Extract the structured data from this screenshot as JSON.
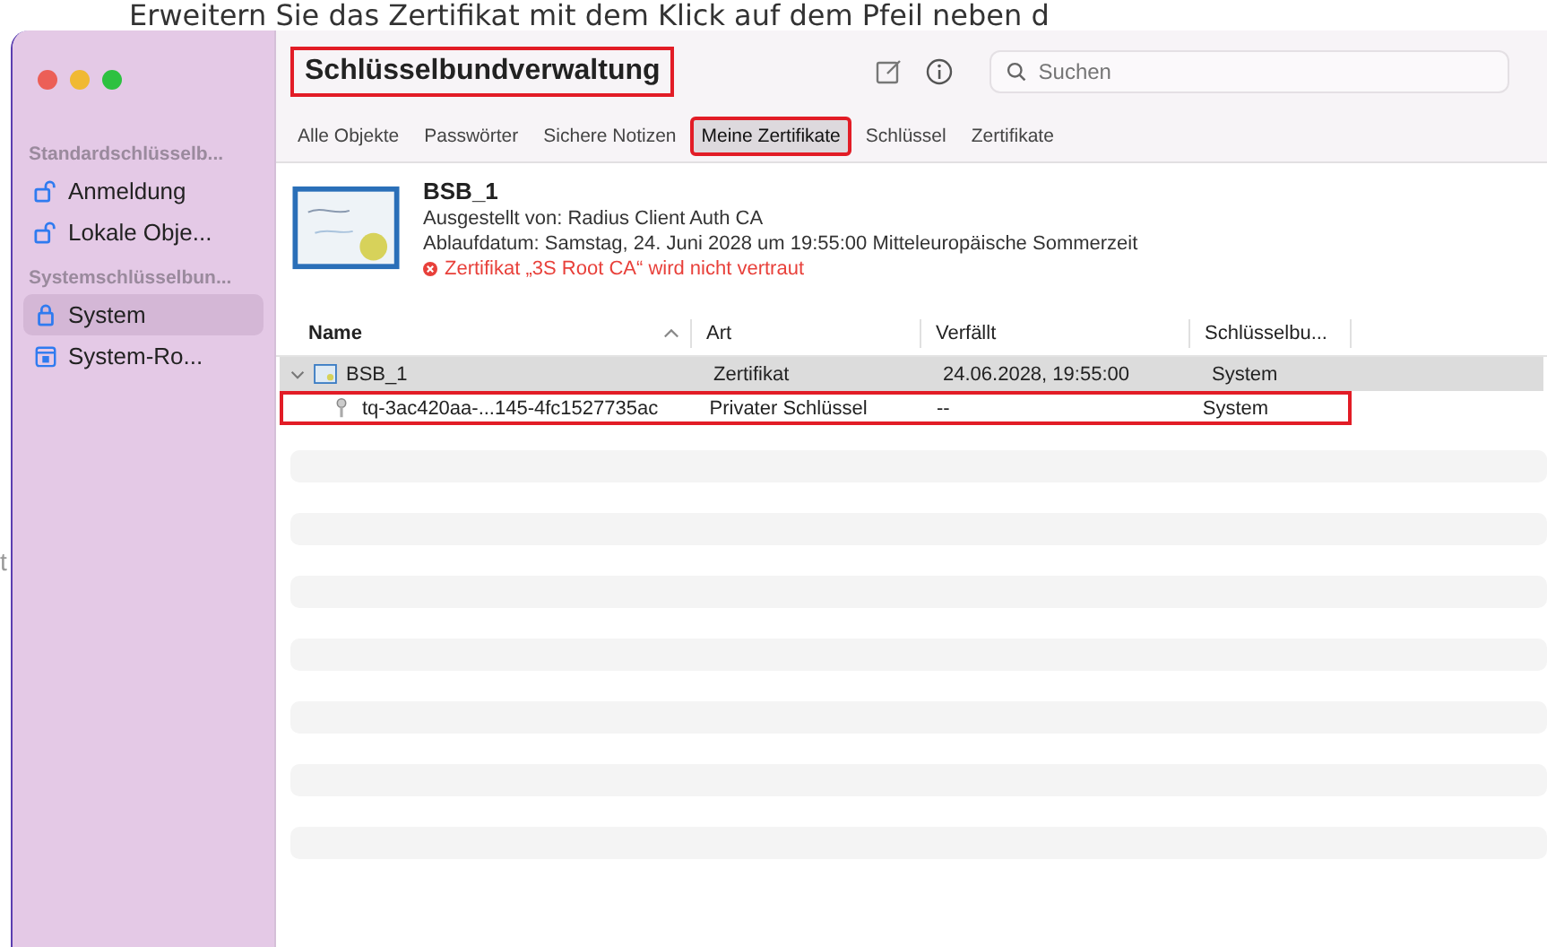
{
  "caption": "Erweitern Sie das Zertifikat mit dem Klick auf dem Pfeil neben d",
  "side_fragment": "t",
  "window": {
    "title": "Schlüsselbundverwaltung",
    "title_annotated": true
  },
  "toolbar": {
    "search": {
      "placeholder": "Suchen"
    }
  },
  "sidebar": {
    "sections": [
      {
        "heading": "Standardschlüsselb...",
        "items": [
          {
            "label": "Anmeldung",
            "kind": "unlocked",
            "selected": false
          },
          {
            "label": "Lokale Obje...",
            "kind": "unlocked",
            "selected": false
          }
        ]
      },
      {
        "heading": "Systemschlüsselbun...",
        "items": [
          {
            "label": "System",
            "kind": "locked",
            "selected": true
          },
          {
            "label": "System-Ro...",
            "kind": "cabinet",
            "selected": false
          }
        ]
      }
    ]
  },
  "tabs": [
    {
      "label": "Alle Objekte",
      "selected": false,
      "annotated": false
    },
    {
      "label": "Passwörter",
      "selected": false,
      "annotated": false
    },
    {
      "label": "Sichere Notizen",
      "selected": false,
      "annotated": false
    },
    {
      "label": "Meine Zertifikate",
      "selected": true,
      "annotated": true
    },
    {
      "label": "Schlüssel",
      "selected": false,
      "annotated": false
    },
    {
      "label": "Zertifikate",
      "selected": false,
      "annotated": false
    }
  ],
  "details": {
    "name": "BSB_1",
    "issuer": "Ausgestellt von: Radius Client Auth CA",
    "expiry": "Ablaufdatum: Samstag, 24. Juni 2028 um 19:55:00 Mitteleuropäische Sommerzeit",
    "warning": "Zertifikat „3S Root CA“ wird nicht vertraut"
  },
  "table": {
    "columns": [
      "Name",
      "Art",
      "Verfällt",
      "Schlüsselbu..."
    ],
    "rows": [
      {
        "name": "BSB_1",
        "kind": "certificate",
        "art": "Zertifikat",
        "expires": "24.06.2028, 19:55:00",
        "keychain": "System",
        "selected": true,
        "expanded": true,
        "annotated": false,
        "children": [
          {
            "name": "tq-3ac420aa-...145-4fc1527735ac",
            "kind": "key",
            "art": "Privater Schlüssel",
            "expires": "--",
            "keychain": "System",
            "selected": false,
            "annotated": true
          }
        ]
      }
    ]
  }
}
